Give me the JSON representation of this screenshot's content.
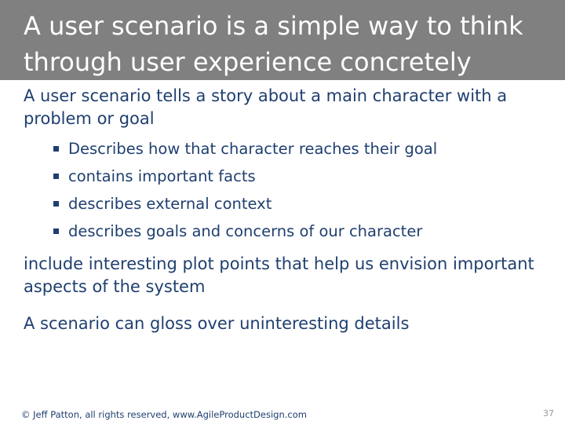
{
  "slide": {
    "title": "A user scenario is a simple way to think through user experience concretely",
    "intro": "A user scenario tells a story about a main character with a problem or goal",
    "bullets": [
      "Describes how that character reaches their goal",
      "contains important facts",
      "describes external context",
      "describes goals and concerns of our character"
    ],
    "para2": "include interesting plot points that help us envision important aspects of the system",
    "para3": "A scenario can gloss over uninteresting details"
  },
  "footer": {
    "copyright": "© Jeff Patton, all rights reserved, www.AgileProductDesign.com",
    "page_number": "37"
  },
  "colors": {
    "title_bar": "#808080",
    "title_text": "#ffffff",
    "body_text": "#1f3f6f",
    "page_number": "#9a9a9a"
  }
}
